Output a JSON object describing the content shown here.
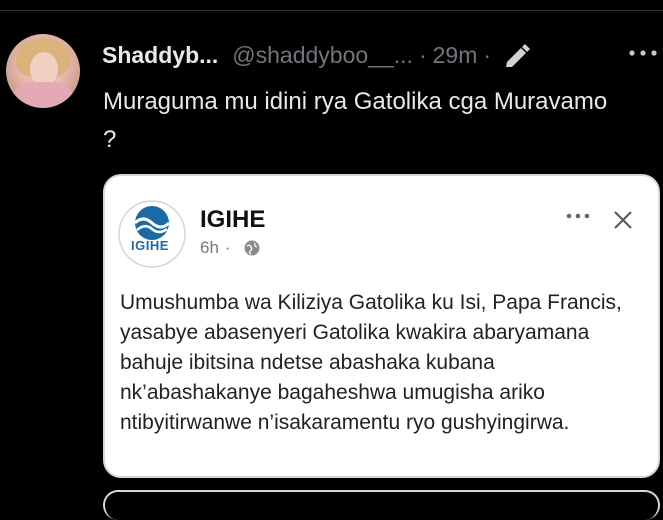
{
  "post": {
    "display_name": "Shaddyb...",
    "handle": "@shaddyboo__...",
    "separator": "·",
    "time": "29m",
    "text": "Muraguma mu idini rya Gatolika cga Muravamo ?"
  },
  "card": {
    "source_name": "IGIHE",
    "logo_text": "IGIHE",
    "age": "6h",
    "separator": "·",
    "body": "Umushumba wa Kiliziya Gatolika ku Isi, Papa Francis, yasabye abasenyeri Gatolika kwakira abaryamana bahuje ibitsina ndetse abashaka kubana nk’abashakanye bagaheshwa umugisha ariko ntibyitirwanwe n’isakaramentu ryo gushyingirwa."
  },
  "colors": {
    "background": "#000000",
    "text": "#e7e9ea",
    "muted": "#71767b",
    "logo_blue": "#1b6aa6"
  }
}
